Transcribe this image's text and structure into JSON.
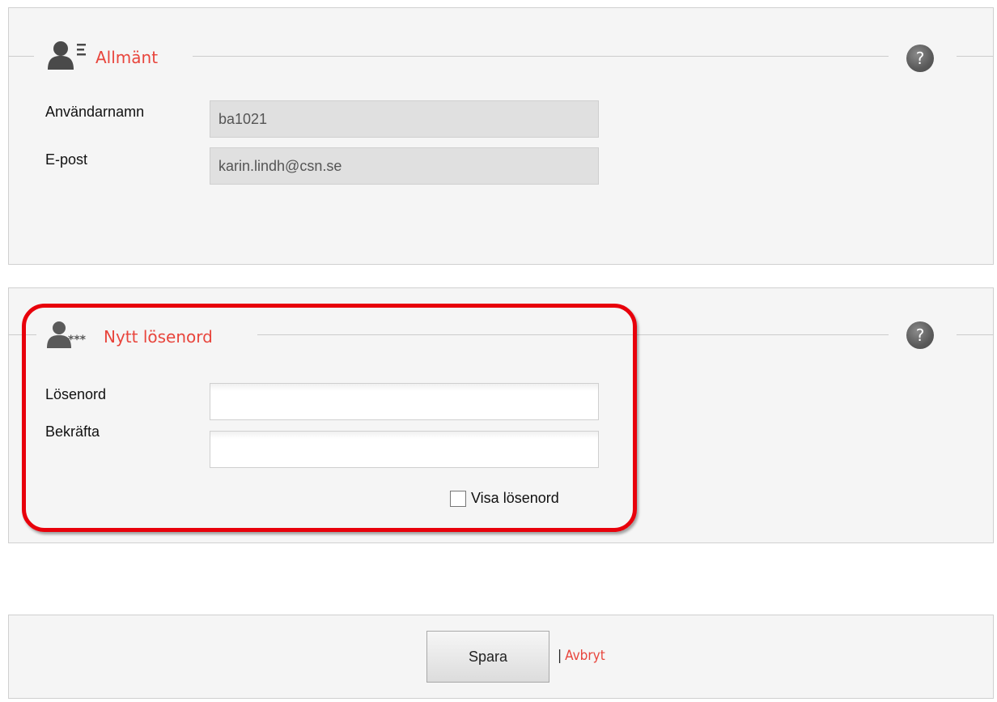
{
  "general": {
    "title": "Allmänt",
    "help": "?",
    "username_label": "Användarnamn",
    "username_value": "ba1021",
    "email_label": "E-post",
    "email_value": "karin.lindh@csn.se"
  },
  "password": {
    "title": "Nytt lösenord",
    "help": "?",
    "password_label": "Lösenord",
    "confirm_label": "Bekräfta",
    "show_password_label": "Visa lösenord"
  },
  "actions": {
    "save_label": "Spara",
    "separator": "|",
    "cancel_label": "Avbryt"
  },
  "colors": {
    "accent": "#e8453c",
    "highlight": "#e8000b"
  }
}
